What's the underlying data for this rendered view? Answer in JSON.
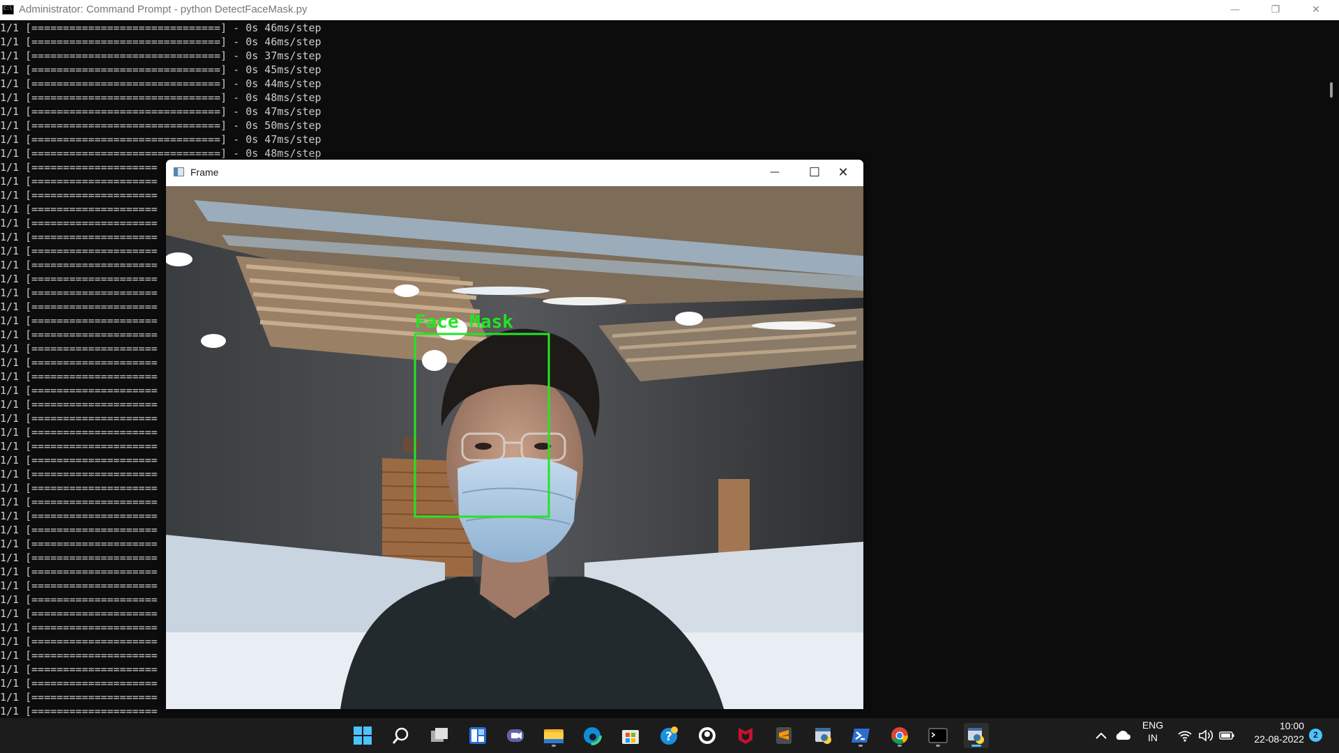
{
  "console": {
    "title": "Administrator: Command Prompt - python  DetectFaceMask.py",
    "lines": [
      "1/1 [==============================] - 0s 46ms/step",
      "1/1 [==============================] - 0s 46ms/step",
      "1/1 [==============================] - 0s 37ms/step",
      "1/1 [==============================] - 0s 45ms/step",
      "1/1 [==============================] - 0s 44ms/step",
      "1/1 [==============================] - 0s 48ms/step",
      "1/1 [==============================] - 0s 47ms/step",
      "1/1 [==============================] - 0s 50ms/step",
      "1/1 [==============================] - 0s 47ms/step",
      "1/1 [==============================] - 0s 48ms/step",
      "1/1 [====================",
      "1/1 [====================",
      "1/1 [====================",
      "1/1 [====================",
      "1/1 [====================",
      "1/1 [====================",
      "1/1 [====================",
      "1/1 [====================",
      "1/1 [====================",
      "1/1 [====================",
      "1/1 [====================",
      "1/1 [====================",
      "1/1 [====================",
      "1/1 [====================",
      "1/1 [====================",
      "1/1 [====================",
      "1/1 [====================",
      "1/1 [====================",
      "1/1 [====================",
      "1/1 [====================",
      "1/1 [====================",
      "1/1 [====================",
      "1/1 [====================",
      "1/1 [====================",
      "1/1 [====================",
      "1/1 [====================",
      "1/1 [====================",
      "1/1 [====================",
      "1/1 [====================",
      "1/1 [====================",
      "1/1 [====================",
      "1/1 [====================",
      "1/1 [====================",
      "1/1 [====================",
      "1/1 [====================",
      "1/1 [====================",
      "1/1 [====================",
      "1/1 [====================",
      "1/1 [====================",
      "1/1 [===================="
    ],
    "controls": {
      "minimize": "—",
      "restore": "❐",
      "close": "✕"
    }
  },
  "frame": {
    "title": "Frame",
    "controls": {
      "minimize": "—",
      "maximize": "☐",
      "close": "✕"
    },
    "detection": {
      "label": "Face Mask",
      "color": "#22e622"
    }
  },
  "taskbar": {
    "apps": [
      "start-icon",
      "search-icon",
      "task-view-icon",
      "widgets-icon",
      "chat-icon",
      "file-explorer-icon",
      "edge-icon",
      "store-icon",
      "help-icon",
      "github-icon",
      "mcafee-icon",
      "sublime-icon",
      "python-idle-icon",
      "powershell-icon",
      "chrome-icon",
      "terminal-icon",
      "python-icon"
    ],
    "tray": {
      "language": "ENG",
      "region": "IN",
      "time": "10:00",
      "date": "22-08-2022",
      "notifications": "2"
    }
  }
}
